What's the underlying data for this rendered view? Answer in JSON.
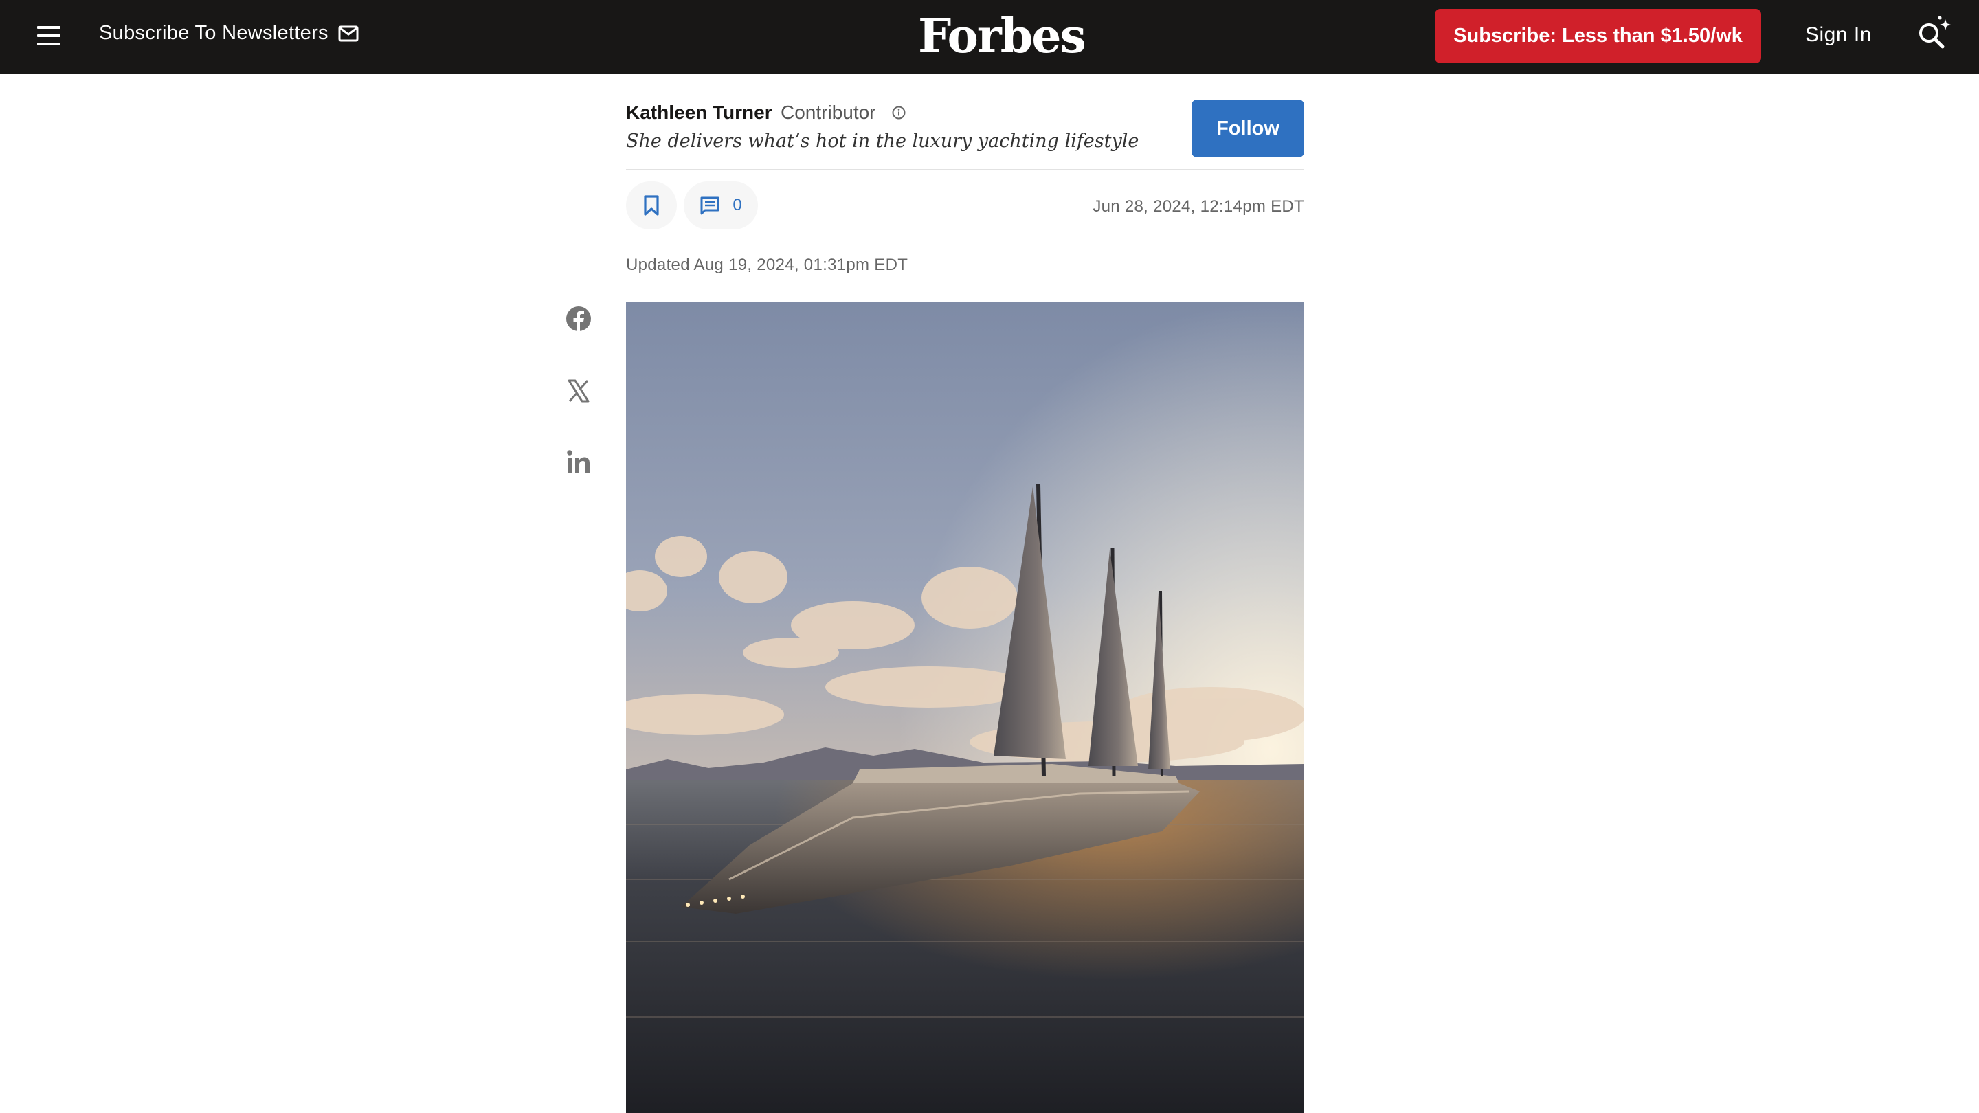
{
  "header": {
    "newsletter_label": "Subscribe To Newsletters",
    "logo_text": "Forbes",
    "subscribe_label": "Subscribe: Less than $1.50/wk",
    "signin_label": "Sign In",
    "icons": [
      "menu-icon",
      "mail-icon",
      "search-sparkle-icon"
    ]
  },
  "author": {
    "name": "Kathleen Turner",
    "role": "Contributor",
    "tagline": "She delivers what’s hot in the luxury yachting lifestyle",
    "follow_label": "Follow"
  },
  "article": {
    "comment_count": "0",
    "published": "Jun 28, 2024, 12:14pm EDT",
    "updated": "Updated Aug 19, 2024, 01:31pm EDT"
  },
  "share": [
    "facebook-icon",
    "x-icon",
    "linkedin-icon"
  ],
  "colors": {
    "header_bg": "#181716",
    "subscribe_red": "#d0202a",
    "follow_blue": "#2f71c1"
  }
}
